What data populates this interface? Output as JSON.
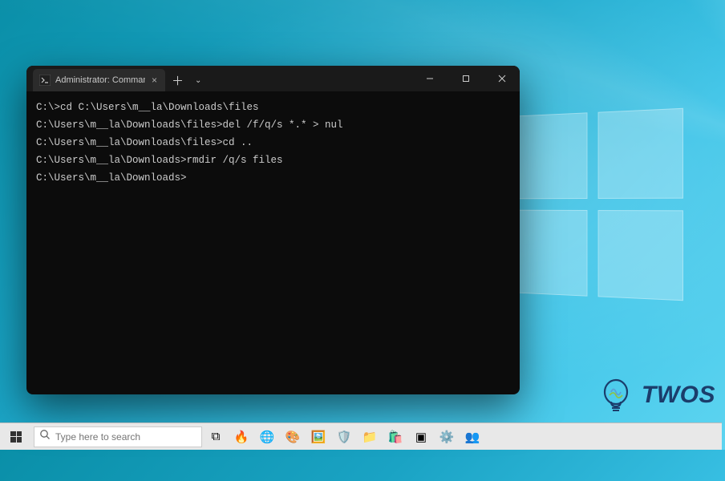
{
  "terminal": {
    "tab": {
      "title": "Administrator: Command Pron",
      "icon_name": "cmd-icon"
    },
    "lines": [
      "C:\\>cd C:\\Users\\m__la\\Downloads\\files",
      "",
      "C:\\Users\\m__la\\Downloads\\files>del /f/q/s *.* > nul",
      "",
      "C:\\Users\\m__la\\Downloads\\files>cd ..",
      "",
      "C:\\Users\\m__la\\Downloads>rmdir /q/s files",
      "",
      "C:\\Users\\m__la\\Downloads>"
    ]
  },
  "taskbar": {
    "search_placeholder": "Type here to search",
    "icons": [
      {
        "name": "task-view-icon",
        "glyph": "⧉"
      },
      {
        "name": "fire-icon",
        "glyph": "🔥"
      },
      {
        "name": "edge-icon",
        "glyph": "🌐"
      },
      {
        "name": "paint-icon",
        "glyph": "🎨"
      },
      {
        "name": "photos-icon",
        "glyph": "🖼️"
      },
      {
        "name": "security-icon",
        "glyph": "🛡️"
      },
      {
        "name": "file-explorer-icon",
        "glyph": "📁"
      },
      {
        "name": "store-icon",
        "glyph": "🛍️"
      },
      {
        "name": "terminal-icon",
        "glyph": "▣"
      },
      {
        "name": "settings-icon",
        "glyph": "⚙️"
      },
      {
        "name": "people-icon",
        "glyph": "👥"
      }
    ]
  },
  "brand": {
    "text": "TWOS"
  }
}
